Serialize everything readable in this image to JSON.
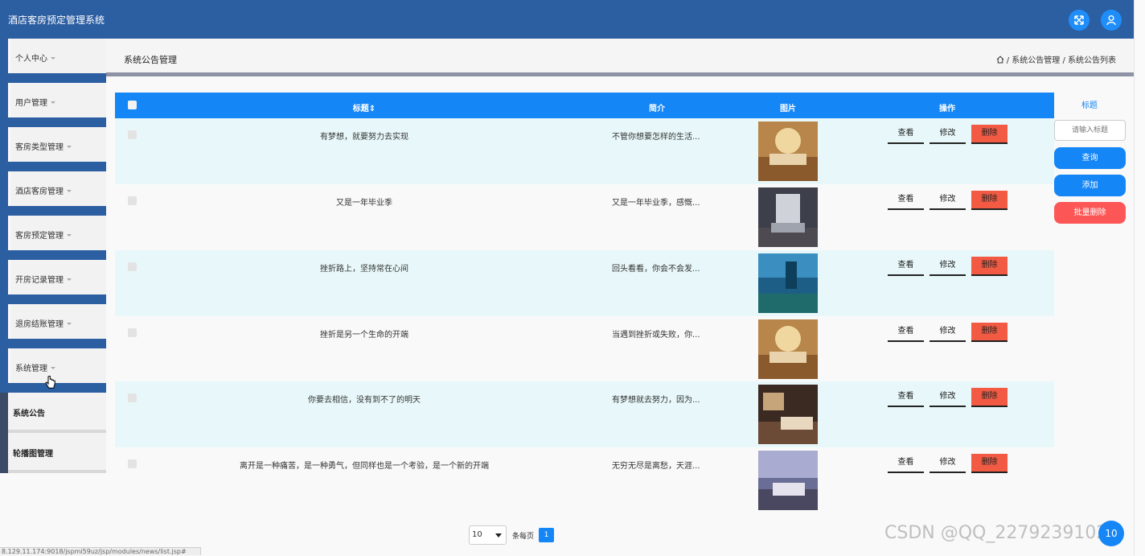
{
  "app": {
    "title": "酒店客房预定管理系统"
  },
  "sidebar": {
    "items": [
      {
        "label": "个人中心"
      },
      {
        "label": "用户管理"
      },
      {
        "label": "客房类型管理"
      },
      {
        "label": "酒店客房管理"
      },
      {
        "label": "客房预定管理"
      },
      {
        "label": "开房记录管理"
      },
      {
        "label": "退房结账管理"
      },
      {
        "label": "系统管理"
      }
    ],
    "sub_items": [
      {
        "label": "系统公告"
      },
      {
        "label": "轮播图管理"
      }
    ]
  },
  "page": {
    "title": "系统公告管理",
    "breadcrumb": [
      "系统公告管理",
      "系统公告列表"
    ],
    "breadcrumb_sep": "/"
  },
  "table": {
    "headers": {
      "title": "标题⇕",
      "summary": "简介",
      "image": "图片",
      "actions": "操作"
    },
    "action_labels": {
      "view": "查看",
      "edit": "修改",
      "delete": "删除"
    },
    "rows": [
      {
        "title": "有梦想，就要努力去实现",
        "summary": "不管你想要怎样的生活..."
      },
      {
        "title": "又是一年毕业季",
        "summary": "又是一年毕业季，感慨..."
      },
      {
        "title": "挫折路上，坚持常在心间",
        "summary": "回头看看，你会不会发..."
      },
      {
        "title": "挫折是另一个生命的开端",
        "summary": "当遇到挫折或失败，你..."
      },
      {
        "title": "你要去相信，没有到不了的明天",
        "summary": "有梦想就去努力，因为..."
      },
      {
        "title": "离开是一种痛苦，是一种勇气，但同样也是一个考验，是一个新的开端",
        "summary": "无穷无尽是离愁，天涯..."
      }
    ]
  },
  "search_panel": {
    "label": "标题",
    "placeholder": "请输入标题",
    "query_button": "查询",
    "add_button": "添加",
    "batch_delete_button": "批量删除"
  },
  "pagination": {
    "page_size": "10",
    "per_page_label": "条每页",
    "current_page": "1"
  },
  "status_bar": {
    "url": "8.129.11.174:9018/jspmi59uz/jsp/modules/news/list.jsp#"
  },
  "watermark": "CSDN @QQ_2279239102",
  "float_button": "10",
  "colors": {
    "topbar": "#2c5ea2",
    "table_header": "#1586f5",
    "row_stripe": "#e8f8fa",
    "delete": "#f25a43",
    "batch_delete": "#fd5656",
    "primary_button": "#1586f5"
  }
}
